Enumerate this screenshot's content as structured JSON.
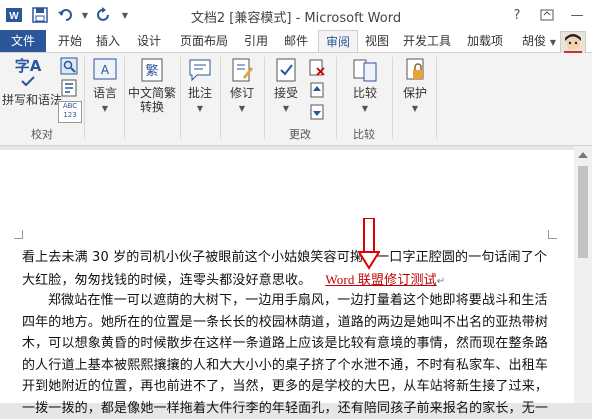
{
  "window": {
    "title": "文档2 [兼容模式] - Microsoft Word",
    "help": "?",
    "minimize": "—",
    "close": "✕",
    "user": "胡俊"
  },
  "tabs": [
    {
      "label": "文件"
    },
    {
      "label": "开始"
    },
    {
      "label": "插入"
    },
    {
      "label": "设计"
    },
    {
      "label": "页面布局"
    },
    {
      "label": "引用"
    },
    {
      "label": "邮件"
    },
    {
      "label": "审阅"
    },
    {
      "label": "视图"
    },
    {
      "label": "开发工具"
    },
    {
      "label": "加载项"
    }
  ],
  "ribbon": {
    "spelling_line1": "字A",
    "spelling_line2": "拼写和语法",
    "group_proofing": "校对",
    "language": "语言",
    "convert_line1": "中文简繁",
    "convert_line2": "转换",
    "comment": "批注",
    "track": "修订",
    "accept": "接受",
    "group_changes": "更改",
    "compare": "比较",
    "group_compare": "比较",
    "protect": "保护",
    "abc_badge": "ABC 123"
  },
  "document": {
    "para1_text": "看上去未满 30 岁的司机小伙子被眼前这个小姑娘笑容可掬、一口字正腔圆的一句话闹了个大红脸，匆匆找钱的时候，连零头都没好意思收。",
    "para1_revision": "Word 联盟修订测试",
    "para_mark": "↵",
    "para2_text": "郑微站在惟一可以遮荫的大树下，一边用手扇风，一边打量着这个她即将要战斗和生活四年的地方。她所在的位置是一条长长的校园林荫道，道路的两边是她叫不出名的亚热带树木，可以想象黄昏的时候散步在这样一条道路上应该是比较有意境的事情，然而现在整条路的人行道上基本被熙熙攘攘的人和大大小小的桌子挤了个水泄不通，不时有私家车、出租车开到她附近的位置，再也前进不了，当然，更多的是学校的大巴，从车站将新生接了过来，一拨一拨的，都是像她一样拖着大件行李的年轻面孔，还有陪同孩子前来报名的家长，无一"
  },
  "colors": {
    "file_tab": "#2b579a",
    "revision_text": "#c00000",
    "annotation_arrow": "#e00000"
  }
}
